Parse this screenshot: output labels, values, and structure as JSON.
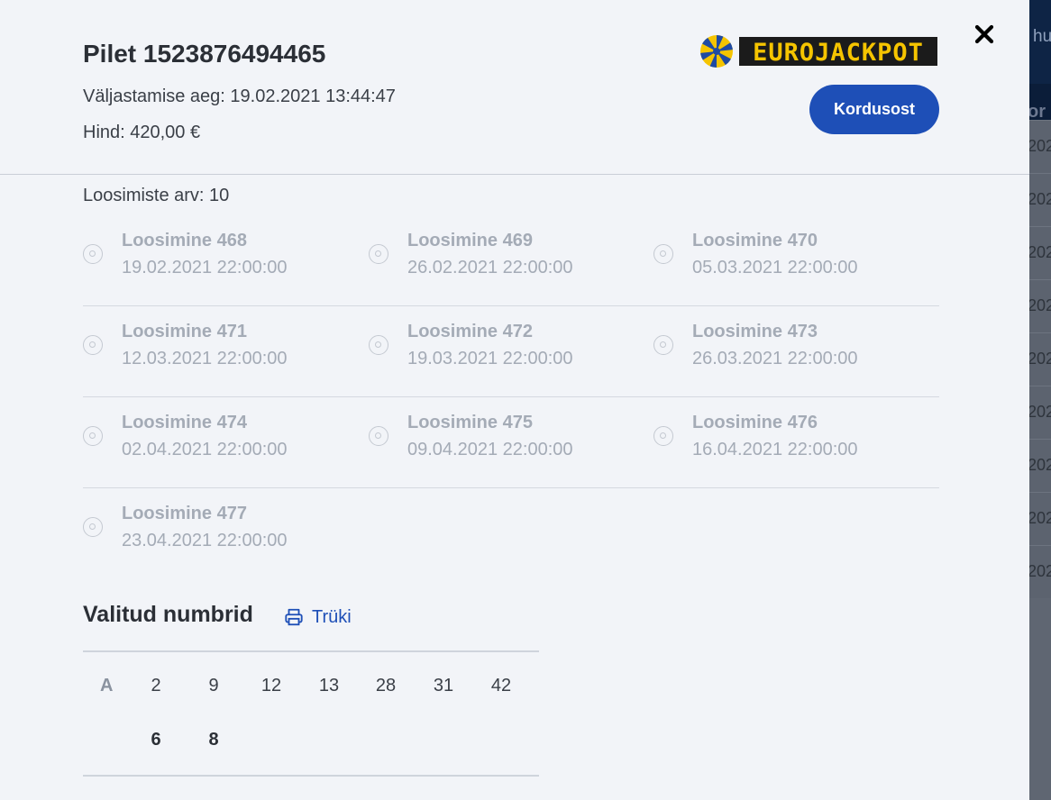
{
  "ticket": {
    "title": "Pilet 1523876494465",
    "issue_time": "Väljastamise aeg: 19.02.2021 13:44:47",
    "price": "Hind: 420,00 €",
    "logo_text": "EUROJACKPOT",
    "repeat_button": "Kordusost"
  },
  "draws": {
    "count_label": "Loosimiste arv: 10",
    "items": [
      {
        "name": "Loosimine 468",
        "date": "19.02.2021 22:00:00"
      },
      {
        "name": "Loosimine 469",
        "date": "26.02.2021 22:00:00"
      },
      {
        "name": "Loosimine 470",
        "date": "05.03.2021 22:00:00"
      },
      {
        "name": "Loosimine 471",
        "date": "12.03.2021 22:00:00"
      },
      {
        "name": "Loosimine 472",
        "date": "19.03.2021 22:00:00"
      },
      {
        "name": "Loosimine 473",
        "date": "26.03.2021 22:00:00"
      },
      {
        "name": "Loosimine 474",
        "date": "02.04.2021 22:00:00"
      },
      {
        "name": "Loosimine 475",
        "date": "09.04.2021 22:00:00"
      },
      {
        "name": "Loosimine 476",
        "date": "16.04.2021 22:00:00"
      },
      {
        "name": "Loosimine 477",
        "date": "23.04.2021 22:00:00"
      }
    ]
  },
  "selected": {
    "title": "Valitud numbrid",
    "print_label": "Trüki",
    "row_label": "A",
    "main_numbers": [
      "2",
      "9",
      "12",
      "13",
      "28",
      "31",
      "42"
    ],
    "euro_numbers": [
      "6",
      "8"
    ]
  },
  "background": {
    "nav_fragment": "hul",
    "header_fragment": "or",
    "row_fragment": "202"
  },
  "colors": {
    "accent": "#1e4fb7",
    "muted_text": "#a4abb6",
    "modal_bg": "#f2f4f8"
  }
}
